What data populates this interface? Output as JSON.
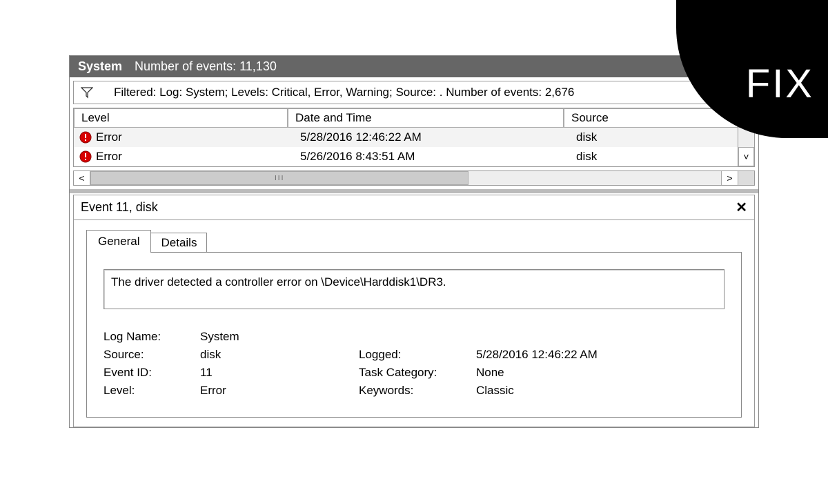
{
  "badge": {
    "label": "FIX"
  },
  "titlebar": {
    "system": "System",
    "count_label": "Number of events: 11,130"
  },
  "filter": {
    "text": "Filtered: Log: System; Levels: Critical, Error, Warning; Source: . Number of events: 2,676"
  },
  "columns": {
    "level": "Level",
    "datetime": "Date and Time",
    "source": "Source"
  },
  "rows": [
    {
      "level": "Error",
      "datetime": "5/28/2016 12:46:22 AM",
      "source": "disk"
    },
    {
      "level": "Error",
      "datetime": "5/26/2016 8:43:51 AM",
      "source": "disk"
    }
  ],
  "detail": {
    "title": "Event 11, disk",
    "tabs": {
      "general": "General",
      "details": "Details"
    },
    "message": "The driver detected a controller error on \\Device\\Harddisk1\\DR3.",
    "props": {
      "log_name_label": "Log Name:",
      "log_name": "System",
      "source_label": "Source:",
      "source": "disk",
      "logged_label": "Logged:",
      "logged": "5/28/2016 12:46:22 AM",
      "event_id_label": "Event ID:",
      "event_id": "11",
      "task_cat_label": "Task Category:",
      "task_cat": "None",
      "level_label": "Level:",
      "level": "Error",
      "keywords_label": "Keywords:",
      "keywords": "Classic"
    }
  },
  "glyphs": {
    "up": "˄",
    "down": "˅",
    "left": "<",
    "right": ">",
    "close": "✕",
    "thumb": "III"
  }
}
